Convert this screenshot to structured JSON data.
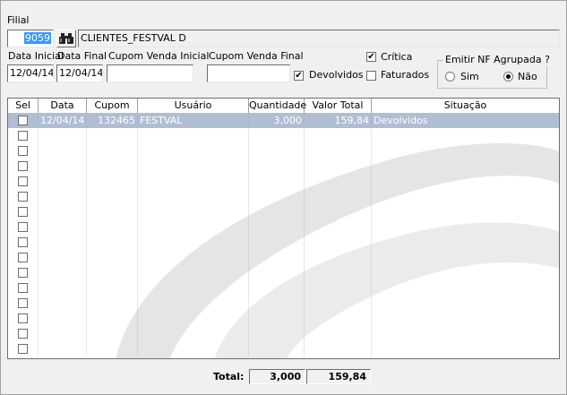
{
  "filial": {
    "label": "Filial",
    "code": "9059",
    "name": "CLIENTES_FESTVAL D"
  },
  "icons": {
    "search": "binoculars-icon"
  },
  "filters": {
    "data_inicial_label": "Data Inicial",
    "data_inicial": "12/04/14",
    "data_final_label": "Data Final",
    "data_final": "12/04/14",
    "cupom_inicial_label": "Cupom Venda Inicial",
    "cupom_inicial": "",
    "cupom_final_label": "Cupom Venda Final",
    "cupom_final": ""
  },
  "checks": {
    "devolvidos_label": "Devolvidos",
    "devolvidos_checked": true,
    "critica_label": "Crítica",
    "critica_checked": true,
    "faturados_label": "Faturados",
    "faturados_checked": false
  },
  "emitir": {
    "legend": "Emitir NF Agrupada ?",
    "sim_label": "Sim",
    "nao_label": "Não",
    "selected": "Não"
  },
  "grid": {
    "headers": [
      "Sel",
      "Data",
      "Cupom",
      "Usuário",
      "Quantidade",
      "Valor Total",
      "Situação"
    ],
    "rows": [
      [
        "",
        "12/04/14",
        "132465",
        "FESTVAL",
        "3,000",
        "159,84",
        "Devolvidos"
      ]
    ],
    "empty_rows": 15
  },
  "totals": {
    "label": "Total:",
    "quantidade": "3,000",
    "valor": "159,84"
  },
  "colors": {
    "selection": "#b0bed4",
    "highlight": "#3399ff"
  }
}
